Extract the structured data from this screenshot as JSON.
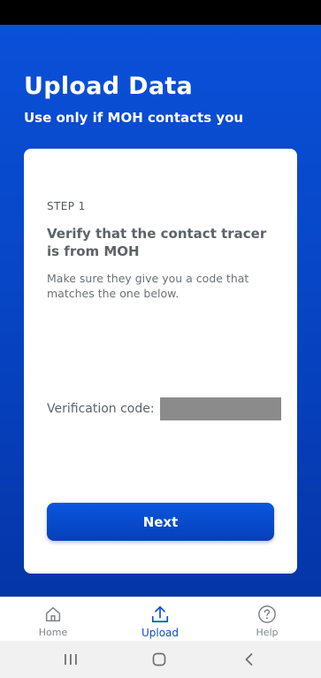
{
  "header": {
    "title": "Upload Data",
    "subtitle": "Use only if MOH contacts you"
  },
  "card": {
    "step_label": "STEP 1",
    "heading": "Verify that the contact tracer is from MOH",
    "description": "Make sure they give you a code that matches the one below.",
    "verification_label": "Verification code:",
    "next_label": "Next"
  },
  "bottom_nav": {
    "items": [
      {
        "label": "Home",
        "icon": "home-icon"
      },
      {
        "label": "Upload",
        "icon": "upload-icon",
        "active": true
      },
      {
        "label": "Help",
        "icon": "help-icon"
      }
    ]
  },
  "system_nav": [
    "recent-apps-icon",
    "home-circle-icon",
    "back-icon"
  ],
  "colors": {
    "primary_blue": "#0a50d8",
    "active_nav": "#0a4fd2",
    "code_redaction": "#8b8b8b"
  }
}
